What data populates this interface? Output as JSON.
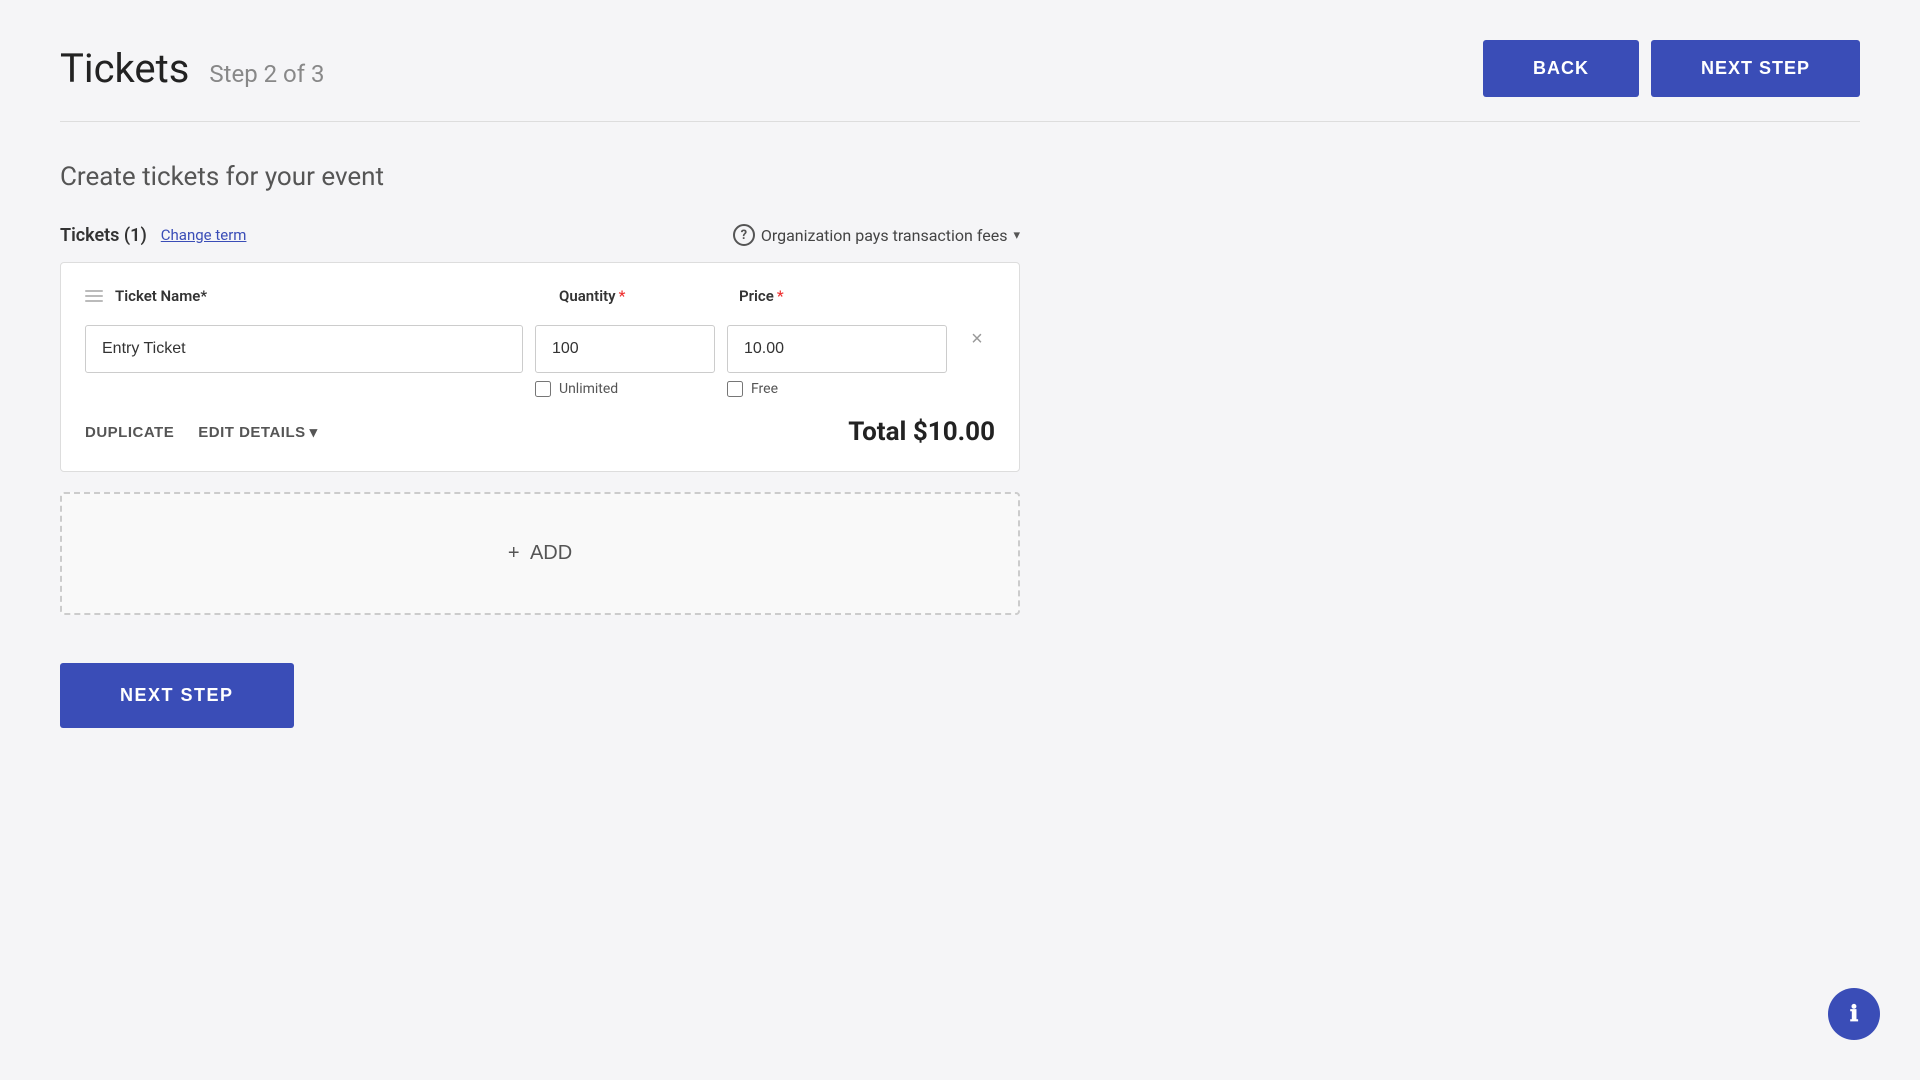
{
  "page": {
    "title": "Tickets",
    "step_label": "Step 2 of 3"
  },
  "header": {
    "back_label": "BACK",
    "next_step_label": "NEXT STEP"
  },
  "content": {
    "section_title": "Create tickets for your event",
    "tickets_label": "Tickets (1)",
    "change_term_label": "Change term",
    "fee_info_label": "Organization pays transaction fees",
    "help_icon_text": "?",
    "dropdown_arrow": "▾"
  },
  "ticket": {
    "col_name_label": "Ticket Name",
    "col_quantity_label": "Quantity",
    "col_price_label": "Price",
    "required_star": "*",
    "name_value": "Entry Ticket",
    "name_placeholder": "",
    "quantity_value": "100",
    "quantity_placeholder": "",
    "price_value": "10.00",
    "price_placeholder": "",
    "unlimited_label": "Unlimited",
    "free_label": "Free",
    "duplicate_label": "DUPLICATE",
    "edit_details_label": "EDIT DETAILS",
    "edit_details_arrow": "▾",
    "total_label": "Total $10.00"
  },
  "add_section": {
    "add_label": "+ ADD"
  },
  "bottom_button": {
    "next_step_label": "NEXT STEP"
  },
  "info_button": {
    "label": "ℹ"
  }
}
